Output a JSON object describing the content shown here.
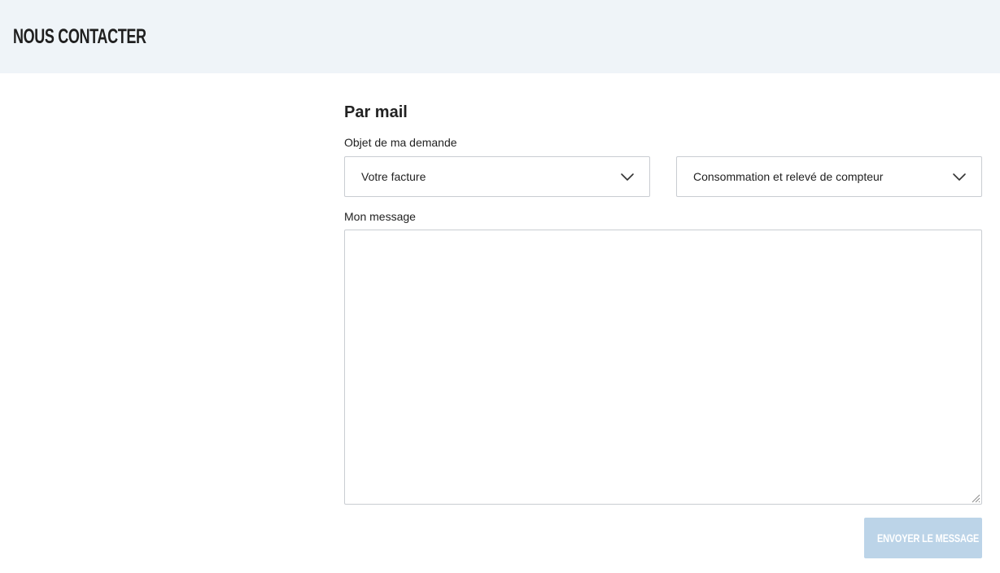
{
  "header": {
    "title": "NOUS CONTACTER",
    "background_color": "#eff4f8"
  },
  "form": {
    "section_title": "Par mail",
    "subject_label": "Objet de ma demande",
    "subject_select": {
      "value": "Votre facture",
      "icon": "chevron-down-icon"
    },
    "topic_select": {
      "value": "Consommation et relevé de compteur",
      "icon": "chevron-down-icon"
    },
    "message_label": "Mon message",
    "message_value": "",
    "message_placeholder": "",
    "send_label": "ENVOYER LE MESSAGE",
    "send_button_color": "#bcd4e8"
  }
}
